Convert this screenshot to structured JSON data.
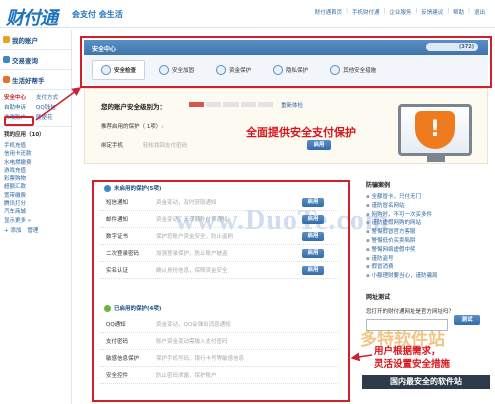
{
  "header": {
    "logo": "财付通",
    "slogan": "会支付 会生活",
    "links": [
      "财付通首页",
      "手机财付通",
      "企业服务",
      "反馈建议",
      "帮助",
      "退出"
    ]
  },
  "sidebar": {
    "sections": [
      {
        "label": "我的账户",
        "color": "#e8a21b"
      },
      {
        "label": "交易查询",
        "color": "#3b87c8"
      },
      {
        "label": "生活好帮手",
        "color": "#e0762a"
      }
    ],
    "sub_items": [
      "安全中心",
      "支付方式",
      "自助申诉",
      "QQ钱包",
      "游戏账户",
      "随便花"
    ],
    "mine_title": "我的应用（10）",
    "apps": [
      "手机充值",
      "信用卡还款",
      "水电燃缴费",
      "游戏充值",
      "彩票购物",
      "超额汇款",
      "宽带缴费",
      "腾讯打分",
      "汽车商城",
      "显示更多 »"
    ],
    "manage": [
      "+ 添加",
      "管理"
    ]
  },
  "security": {
    "bar_title": "安全中心",
    "user_masked": "(372)",
    "tabs": [
      "安全检查",
      "安全加固",
      "资金保护",
      "隐私保护",
      "其他安全措施"
    ],
    "level_label": "您的账户安全级别为：",
    "level_segments_on": 1,
    "level_segments_total": 5,
    "recheck": "重新体检",
    "recommend": "推荐启用的保护（ 1项）:",
    "phone_label": "绑定手机",
    "phone_desc": "轻松找回支付密码",
    "enable": "启用",
    "banner": "全面提供安全支付保护"
  },
  "protections": {
    "not_enabled_title": "未启用的保护(5项)",
    "not_enabled": [
      {
        "name": "短信通知",
        "desc": "资金变动，及时获取通知"
      },
      {
        "name": "邮件通知",
        "desc": "资金变动，无须额外付费通知"
      },
      {
        "name": "数字证书",
        "desc": "保护您账户资金安全，防止盗刷"
      },
      {
        "name": "二次登录密码",
        "desc": "加强登录保护，防止账户被盗"
      },
      {
        "name": "实名认证",
        "desc": "确认身份信息，保障资金安全"
      }
    ],
    "enabled_title": "已启用的保护(4项)",
    "enabled": [
      {
        "name": "QQ通知",
        "desc": "资金变动，QQ会弹出消息通知"
      },
      {
        "name": "支付密码",
        "desc": "账户资金变动需输入支付密码"
      },
      {
        "name": "敏感信息保护",
        "desc": "保护手机号码、银行卡号等敏感信息"
      },
      {
        "name": "安全控件",
        "desc": "防止密码泄露，保护账户"
      }
    ]
  },
  "cases": {
    "title": "防骗案例",
    "items": [
      "全额冒卡，只付无门",
      "谨防冒名网站",
      "网购时，不可一次买多件",
      "谨防虚假网购的网站",
      "警惕假冒官方客服",
      "警惕低价买卖陷阱",
      "警惕网络虚假中奖",
      "谨防盗号",
      "假冒消费",
      "小额理财要当心，谨防骗局"
    ]
  },
  "net_test": {
    "title": "网址测试",
    "question": "您打开的财付通网址是官方网址吗？",
    "button": "测试"
  },
  "annotation": {
    "line1": "用户根据需求，",
    "line2": "灵活设置安全措施"
  },
  "watermarks": {
    "duote": "www.DuoTe.com",
    "brand": "多特软件站",
    "brand_sub": "国内最安全的软件站"
  }
}
